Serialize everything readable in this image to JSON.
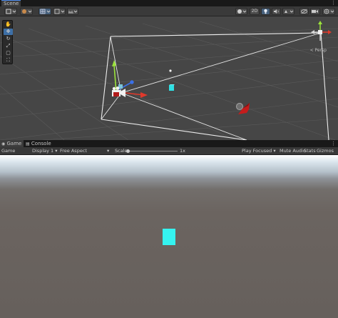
{
  "scene_tab": {
    "label": "Scene"
  },
  "toolbar": {
    "mode_2d": "2D"
  },
  "tools": [
    "hand",
    "move",
    "rotate",
    "scale",
    "rect",
    "transform"
  ],
  "scene_view": {
    "persp_label": "< Persp"
  },
  "lower_tabs": {
    "game": "Game",
    "console": "Console"
  },
  "gamebar": {
    "game_label": "Game",
    "display": "Display 1",
    "aspect": "Free Aspect",
    "scale_label": "Scale",
    "scale_value": "1x",
    "play_focused": "Play Focused",
    "mute": "Mute Audio",
    "stats": "Stats",
    "gizmos": "Gizmos"
  },
  "colors": {
    "cube": "#35f3f0",
    "axis_x": "#e0392b",
    "axis_y": "#9be33b",
    "axis_z": "#3a70e8",
    "selection": "#3d6fa6"
  }
}
